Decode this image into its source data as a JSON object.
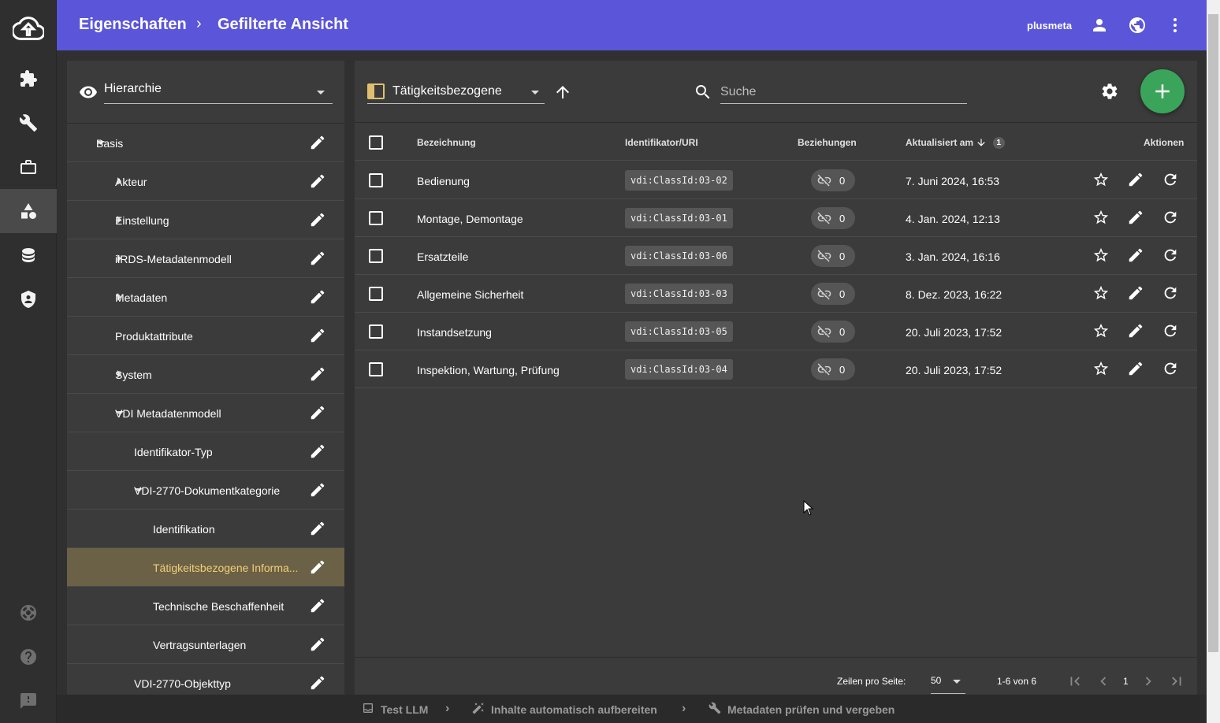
{
  "header": {
    "breadcrumb_root": "Eigenschaften",
    "breadcrumb_current": "Gefilterte Ansicht",
    "breadcrumb_sep": "›",
    "user": "plusmeta"
  },
  "rail": {
    "items": [
      "cloud-upload-icon",
      "puzzle-icon",
      "wrench-icon",
      "briefcase-icon",
      "shapes-icon",
      "database-icon",
      "shield-icon",
      "lifebuoy-icon",
      "help-icon",
      "feedback-icon"
    ],
    "active": "shapes-icon"
  },
  "left_panel": {
    "view_select": "Hierarchie",
    "tree": [
      {
        "label": "Basis",
        "level": 0,
        "expand": "down"
      },
      {
        "label": "Akteur",
        "level": 1,
        "expand": "right"
      },
      {
        "label": "Einstellung",
        "level": 1,
        "expand": "right"
      },
      {
        "label": "iiRDS-Metadatenmodell",
        "level": 1,
        "expand": "right"
      },
      {
        "label": "Metadaten",
        "level": 1,
        "expand": "right"
      },
      {
        "label": "Produktattribute",
        "level": 1,
        "expand": "none"
      },
      {
        "label": "System",
        "level": 1,
        "expand": "right"
      },
      {
        "label": "VDI Metadatenmodell",
        "level": 1,
        "expand": "down"
      },
      {
        "label": "Identifikator-Typ",
        "level": 2,
        "expand": "none"
      },
      {
        "label": "VDI-2770-Dokumentkategorie",
        "level": 2,
        "expand": "down"
      },
      {
        "label": "Identifikation",
        "level": 3,
        "expand": "none"
      },
      {
        "label": "Tätigkeitsbezogene Informa...",
        "level": 3,
        "expand": "none",
        "selected": true
      },
      {
        "label": "Technische Beschaffenheit",
        "level": 3,
        "expand": "none"
      },
      {
        "label": "Vertragsunterlagen",
        "level": 3,
        "expand": "none"
      },
      {
        "label": "VDI-2770-Objekttyp",
        "level": 2,
        "expand": "none"
      }
    ]
  },
  "right_panel": {
    "filter_label": "Tätigkeitsbezogene",
    "search_placeholder": "Suche",
    "columns": {
      "name": "Bezeichnung",
      "uri": "Identifikator/URI",
      "relations": "Beziehungen",
      "updated": "Aktualisiert am",
      "updated_sort_index": "1",
      "actions": "Aktionen"
    },
    "rows": [
      {
        "name": "Bedienung",
        "uri": "vdi:ClassId:03-02",
        "relations": "0",
        "updated": "7. Juni 2024, 16:53"
      },
      {
        "name": "Montage, Demontage",
        "uri": "vdi:ClassId:03-01",
        "relations": "0",
        "updated": "4. Jan. 2024, 12:13"
      },
      {
        "name": "Ersatzteile",
        "uri": "vdi:ClassId:03-06",
        "relations": "0",
        "updated": "3. Jan. 2024, 16:16"
      },
      {
        "name": "Allgemeine Sicherheit",
        "uri": "vdi:ClassId:03-03",
        "relations": "0",
        "updated": "8. Dez. 2023, 16:22"
      },
      {
        "name": "Instandsetzung",
        "uri": "vdi:ClassId:03-05",
        "relations": "0",
        "updated": "20. Juli 2023, 17:52"
      },
      {
        "name": "Inspektion, Wartung, Prüfung",
        "uri": "vdi:ClassId:03-04",
        "relations": "0",
        "updated": "20. Juli 2023, 17:52"
      }
    ],
    "footer": {
      "rows_per_page_label": "Zeilen pro Seite:",
      "rows_per_page": "50",
      "range": "1-6 von 6",
      "page": "1"
    }
  },
  "bottom_bar": {
    "steps": [
      "Test LLM",
      "Inhalte automatisch aufbereiten",
      "Metadaten prüfen und vergeben"
    ]
  },
  "colors": {
    "header": "#5a55d9",
    "fab": "#3aa55a",
    "selected_row": "#6b6146",
    "selected_text": "#f0cf7a"
  }
}
